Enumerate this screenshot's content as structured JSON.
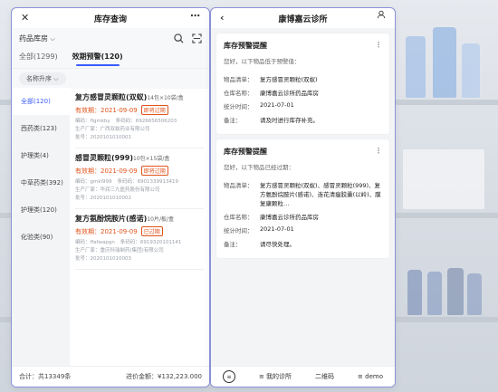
{
  "left": {
    "title": "库存查询",
    "warehouse": "药品库房",
    "tabs": [
      "全部(1299)",
      "效期预警(120)"
    ],
    "sort": "名称升序",
    "sidebar": [
      "全部(120)",
      "西药类(123)",
      "护理类(4)",
      "中草药类(392)",
      "护理类(120)",
      "化验类(90)"
    ],
    "cards": [
      {
        "name": "复方感冒灵颗粒(双蚁)",
        "spec": "14包×10袋/盒",
        "exp": "有效期：2021-09-09",
        "badge": "即将过期",
        "line1a": "编码：flgmkby",
        "line1b": "条码码：6926656506203",
        "line2": "生产厂家：广西双蚁药业有限公司",
        "line3": "批号：2020101010001"
      },
      {
        "name": "感冒灵颗粒(999)",
        "spec": "10包×15袋/盒",
        "exp": "有效期：2021-09-09",
        "badge": "即将过期",
        "line1a": "编码：gmkl999",
        "line1b": "条码码：6901339913419",
        "line2": "生产厂家：华润三九医药股份有限公司",
        "line3": "批号：2020101010002"
      },
      {
        "name": "复方氨酚烷胺片(感诺)",
        "spec": "10片/板/盒",
        "exp": "有效期：2021-09-09",
        "badge": "已过期",
        "line1a": "编码：ffafwapgn",
        "line1b": "条码码：6919320101141",
        "line2": "生产厂家：重庆科瑞制药(集团)有限公司",
        "line3": "批号：2020101010003"
      }
    ],
    "footer_left": "合计：共13349条",
    "footer_right": "进价金额：¥132,223.000"
  },
  "right": {
    "title": "康博嘉云诊所",
    "notice1": {
      "title": "库存预警提醒",
      "hint": "您好，以下物品低于预警值：",
      "items_label": "物品清单：",
      "items": "复方感冒灵颗粒(双蚁)",
      "warehouse_label": "仓库名称：",
      "warehouse": "康博嘉云诊所药品库房",
      "time_label": "统计时间：",
      "time": "2021-07-01",
      "note_label": "备注：",
      "note": "请及时进行库存补充。"
    },
    "notice2": {
      "title": "库存预警提醒",
      "hint": "您好，以下物品已经过期：",
      "items_label": "物品清单：",
      "items": "复方感冒灵颗粒(双蚁)、感冒灵颗粒(999)、复方氨酚烷胺片(感诺)、连花清瘟胶囊(以岭)、膜复康颗粒…",
      "warehouse_label": "仓库名称：",
      "warehouse": "康博嘉云诊所药品库房",
      "time_label": "统计时间：",
      "time": "2021-07-01",
      "note_label": "备注：",
      "note": "请尽快处理。"
    },
    "footer": [
      "≡ 我的诊所",
      "二维码",
      "≡ demo"
    ]
  }
}
